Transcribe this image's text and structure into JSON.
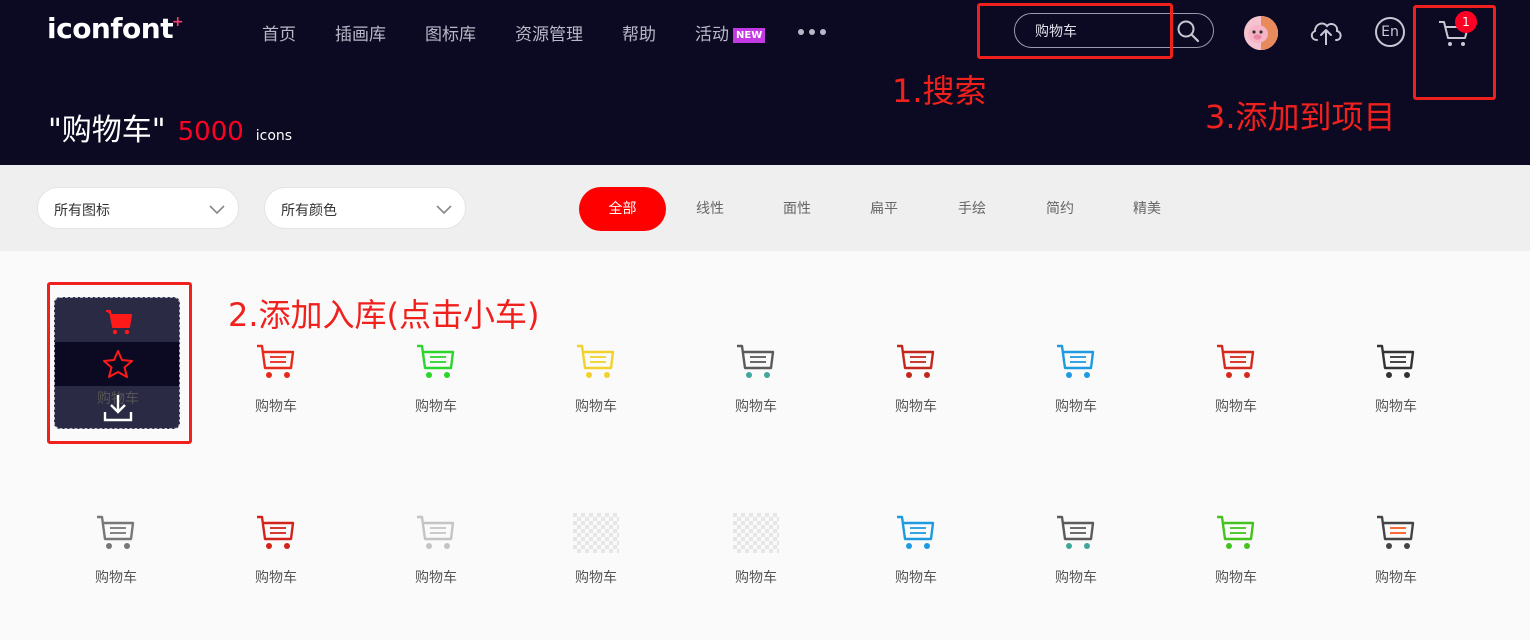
{
  "header": {
    "logo": "iconfont",
    "logo_plus": "+",
    "nav": [
      {
        "label": "首页"
      },
      {
        "label": "插画库"
      },
      {
        "label": "图标库"
      },
      {
        "label": "资源管理"
      },
      {
        "label": "帮助"
      },
      {
        "label": "活动",
        "badge": "NEW"
      }
    ],
    "search": {
      "value": "购物车"
    },
    "lang_label": "En",
    "cart_count": "1"
  },
  "result": {
    "query": "\"购物车\"",
    "count": "5000",
    "unit": "icons"
  },
  "annotations": {
    "step1": "1.搜索",
    "step2": "2.添加入库(点击小车)",
    "step3": "3.添加到项目"
  },
  "filters": {
    "dropdown1": "所有图标",
    "dropdown2": "所有颜色",
    "pills": [
      "全部",
      "线性",
      "面性",
      "扁平",
      "手绘",
      "简约",
      "精美"
    ]
  },
  "icons": [
    {
      "name": "购物车",
      "color": "#e82a1d",
      "style": "hovered"
    },
    {
      "name": "购物车",
      "color": "#e82a1d",
      "style": "cart"
    },
    {
      "name": "购物车",
      "color": "#2bd62b",
      "style": "cart"
    },
    {
      "name": "购物车",
      "color": "#f2d22a",
      "style": "cart"
    },
    {
      "name": "购物车",
      "color": "#5b5b5b",
      "wheel": "#3fa89a",
      "style": "cart"
    },
    {
      "name": "购物车",
      "color": "#c2271c",
      "style": "cart"
    },
    {
      "name": "购物车",
      "color": "#1e9be0",
      "style": "cart"
    },
    {
      "name": "购物车",
      "color": "#d6291d",
      "style": "cart"
    },
    {
      "name": "购物车",
      "color": "#333333",
      "style": "cart"
    },
    {
      "name": "购物车",
      "color": "#777777",
      "style": "cart"
    },
    {
      "name": "购物车",
      "color": "#d3221a",
      "style": "cart"
    },
    {
      "name": "购物车",
      "color": "#c4c4c4",
      "style": "cart"
    },
    {
      "name": "购物车",
      "color": "#dddddd",
      "style": "transparent"
    },
    {
      "name": "购物车",
      "color": "#dddddd",
      "style": "transparent"
    },
    {
      "name": "购物车",
      "color": "#1e9be0",
      "style": "cart"
    },
    {
      "name": "购物车",
      "color": "#5b5b5b",
      "wheel": "#3fa89a",
      "style": "cart"
    },
    {
      "name": "购物车",
      "color": "#44c21d",
      "style": "cart"
    },
    {
      "name": "购物车",
      "color": "#444444",
      "accent": "#ff5a1f",
      "style": "cart"
    }
  ]
}
